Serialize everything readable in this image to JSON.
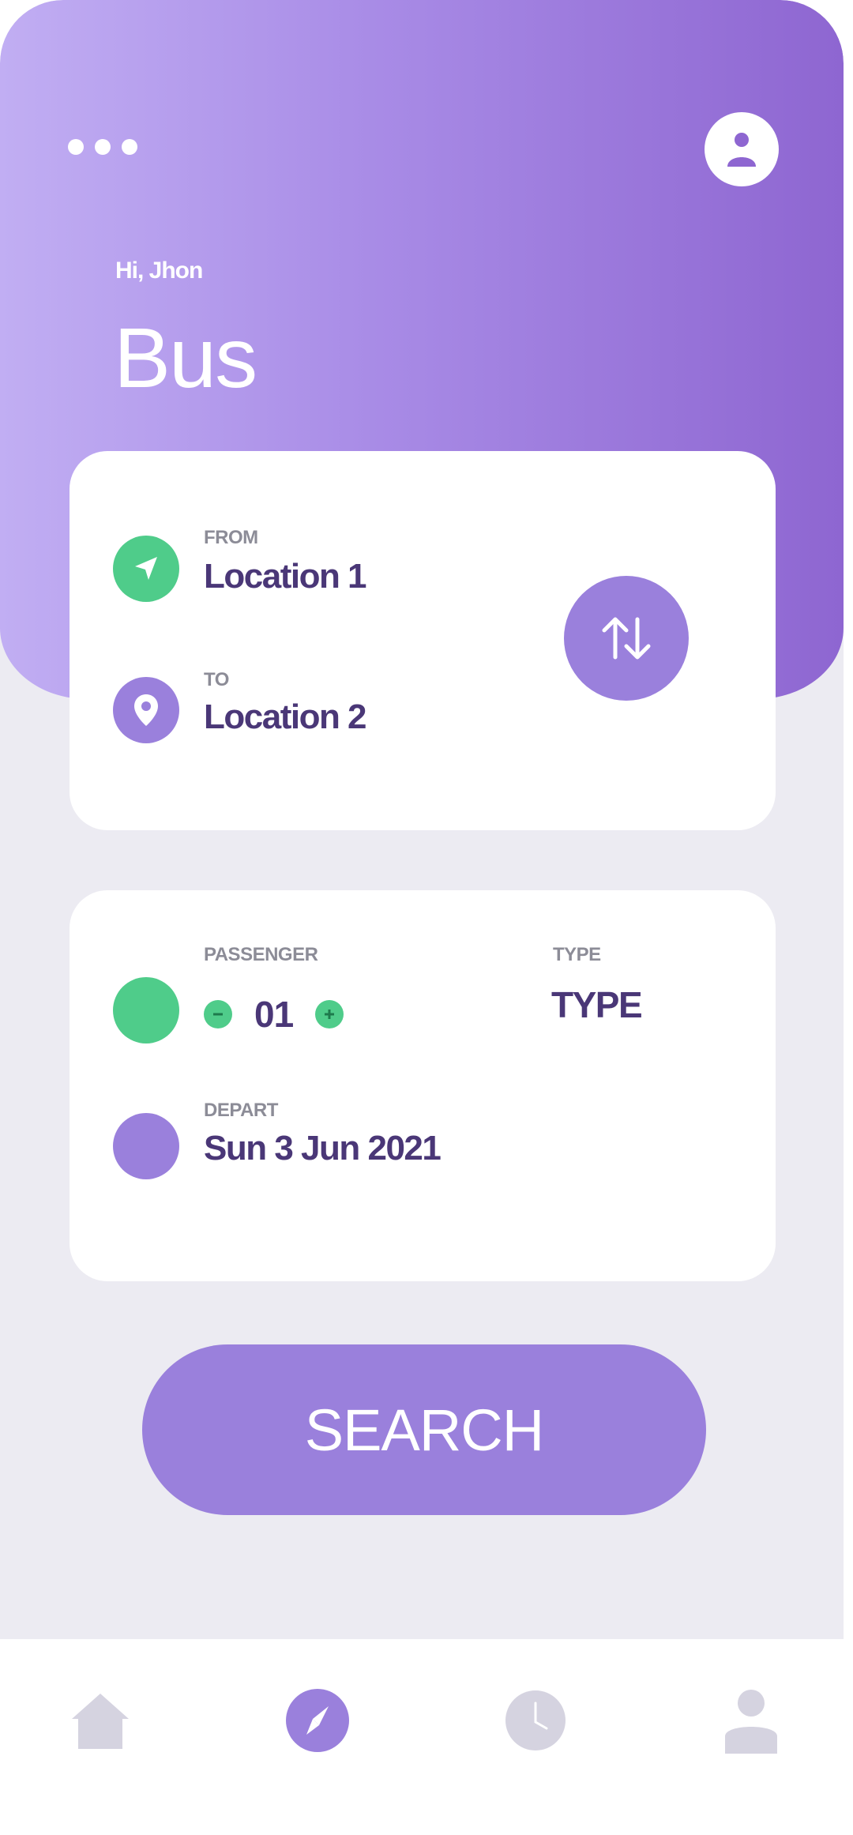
{
  "header": {
    "greeting": "Hi, Jhon",
    "title": "Bus"
  },
  "route": {
    "from_label": "FROM",
    "from_value": "Location 1",
    "to_label": "TO",
    "to_value": "Location 2"
  },
  "details": {
    "passenger_label": "PASSENGER",
    "passenger_count": "01",
    "type_label": "TYPE",
    "type_value": "TYPE",
    "depart_label": "DEPART",
    "depart_value": "Sun 3 Jun 2021"
  },
  "search_label": "SEARCH",
  "bottom_nav": {
    "items": [
      {
        "icon": "home-icon",
        "active": false
      },
      {
        "icon": "compass-icon",
        "active": true
      },
      {
        "icon": "clock-icon",
        "active": false
      },
      {
        "icon": "person-icon",
        "active": false
      }
    ]
  },
  "colors": {
    "accent_purple": "#9A80DC",
    "accent_green": "#4FCC8A",
    "text_dark": "#4A3777",
    "background": "#ECEBF2",
    "nav_inactive": "#D5D3E0"
  }
}
